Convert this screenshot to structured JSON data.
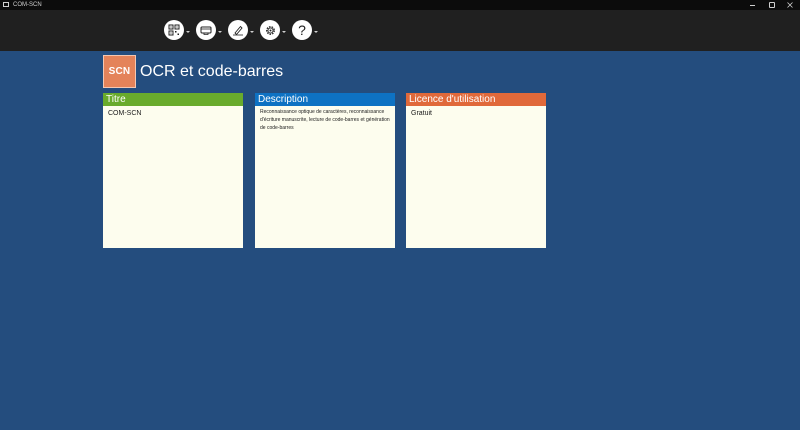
{
  "window": {
    "title": "COM-SCN"
  },
  "toolbar": {
    "buttons": [
      {
        "icon": "qr-code-icon"
      },
      {
        "icon": "scanner-icon"
      },
      {
        "icon": "signature-icon"
      },
      {
        "icon": "gear-icon"
      },
      {
        "icon": "help-icon",
        "glyph": "?"
      }
    ]
  },
  "header": {
    "logo_text": "SCN",
    "title": "OCR et code-barres"
  },
  "cards": {
    "title": {
      "header": "Titre",
      "body": "COM-SCN",
      "color": "#69ab2c"
    },
    "description": {
      "header": "Description",
      "body": "Reconnaissance optique de caractères, reconnaissance d'écriture manuscrite, lecture de code-barres et génération de code-barres",
      "color": "#0e72c3"
    },
    "license": {
      "header": "Licence d'utilisation",
      "body": "Gratuit",
      "color": "#e0693a"
    }
  },
  "colors": {
    "background": "#244d7e",
    "toolbar": "#202020",
    "titlebar": "#0c0c0c",
    "card_body": "#fdfdee",
    "logo": "#e4835a"
  }
}
